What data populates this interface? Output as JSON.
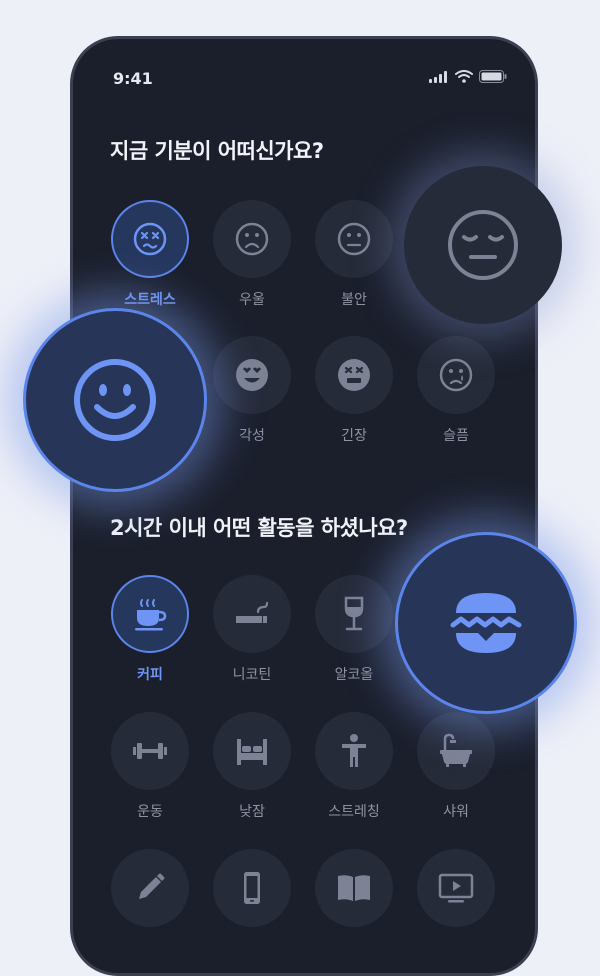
{
  "status_bar": {
    "time": "9:41"
  },
  "mood_section": {
    "question": "지금 기분이 어떠신가요?",
    "moods": [
      {
        "label": "스트레스",
        "icon": "dizzy-face-icon",
        "selected": true
      },
      {
        "label": "우울",
        "icon": "sad-face-icon",
        "selected": false
      },
      {
        "label": "불안",
        "icon": "neutral-face-icon",
        "selected": false
      },
      {
        "label": "각성",
        "icon": "heart-eyes-face-icon",
        "selected": false
      },
      {
        "label": "긴장",
        "icon": "tense-face-icon",
        "selected": false
      },
      {
        "label": "슬픔",
        "icon": "crying-face-icon",
        "selected": false
      }
    ]
  },
  "activity_section": {
    "question": "2시간 이내 어떤 활동을 하셨나요?",
    "activities": [
      {
        "label": "커피",
        "icon": "coffee-icon",
        "selected": true
      },
      {
        "label": "니코틴",
        "icon": "cigarette-icon",
        "selected": false
      },
      {
        "label": "알코올",
        "icon": "wine-glass-icon",
        "selected": false
      },
      {
        "label": "운동",
        "icon": "dumbbell-icon",
        "selected": false
      },
      {
        "label": "낮잠",
        "icon": "bed-icon",
        "selected": false
      },
      {
        "label": "스트레칭",
        "icon": "stretching-person-icon",
        "selected": false
      },
      {
        "label": "샤워",
        "icon": "bathtub-icon",
        "selected": false
      },
      {
        "label": "",
        "icon": "pencil-icon",
        "selected": false
      },
      {
        "label": "",
        "icon": "smartphone-icon",
        "selected": false
      },
      {
        "label": "",
        "icon": "book-icon",
        "selected": false
      },
      {
        "label": "",
        "icon": "tv-play-icon",
        "selected": false
      }
    ]
  },
  "colors": {
    "accent": "#5b85ea",
    "accent_text": "#6e95f5",
    "icon_muted": "#7d8294",
    "screen_bg": "#1b1f2c",
    "cell_bg": "#262b39"
  }
}
